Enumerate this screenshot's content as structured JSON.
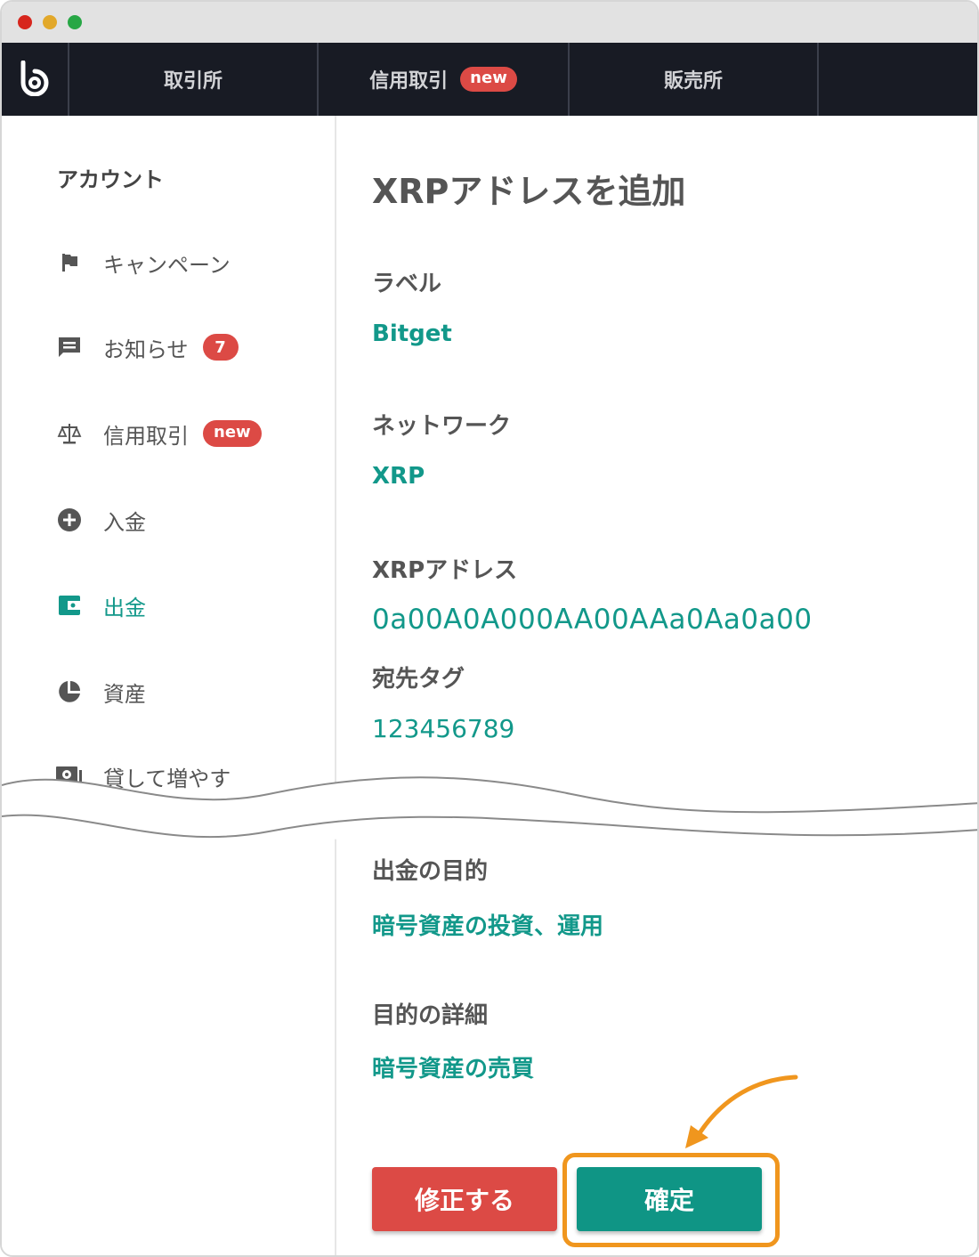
{
  "nav": {
    "tabs": [
      "取引所",
      "信用取引",
      "販売所"
    ],
    "new_badge": "new"
  },
  "sidebar": {
    "heading": "アカウント",
    "items": [
      {
        "label": "キャンペーン",
        "icon": "flag-icon"
      },
      {
        "label": "お知らせ",
        "icon": "message-icon",
        "badge": "7"
      },
      {
        "label": "信用取引",
        "icon": "scale-icon",
        "badge": "new"
      },
      {
        "label": "入金",
        "icon": "plus-circle-icon"
      },
      {
        "label": "出金",
        "icon": "wallet-icon",
        "active": true
      },
      {
        "label": "資産",
        "icon": "pie-chart-icon"
      },
      {
        "label": "貸して増やす",
        "icon": "cash-icon"
      }
    ]
  },
  "form": {
    "title": "XRPアドレスを追加",
    "label_title": "ラベル",
    "label_value": "Bitget",
    "network_title": "ネットワーク",
    "network_value": "XRP",
    "address_title": "XRPアドレス",
    "address_value": "0a00A0A000AA00AAa0Aa0a00",
    "tag_title": "宛先タグ",
    "tag_value": "123456789",
    "purpose_title": "出金の目的",
    "purpose_value": "暗号資産の投資、運用",
    "detail_title": "目的の詳細",
    "detail_value": "暗号資産の売買"
  },
  "buttons": {
    "fix": "修正する",
    "confirm": "確定"
  },
  "colors": {
    "accent": "#12988a",
    "danger": "#dc4a45",
    "highlight": "#f0961e",
    "navbar": "#181b24"
  }
}
